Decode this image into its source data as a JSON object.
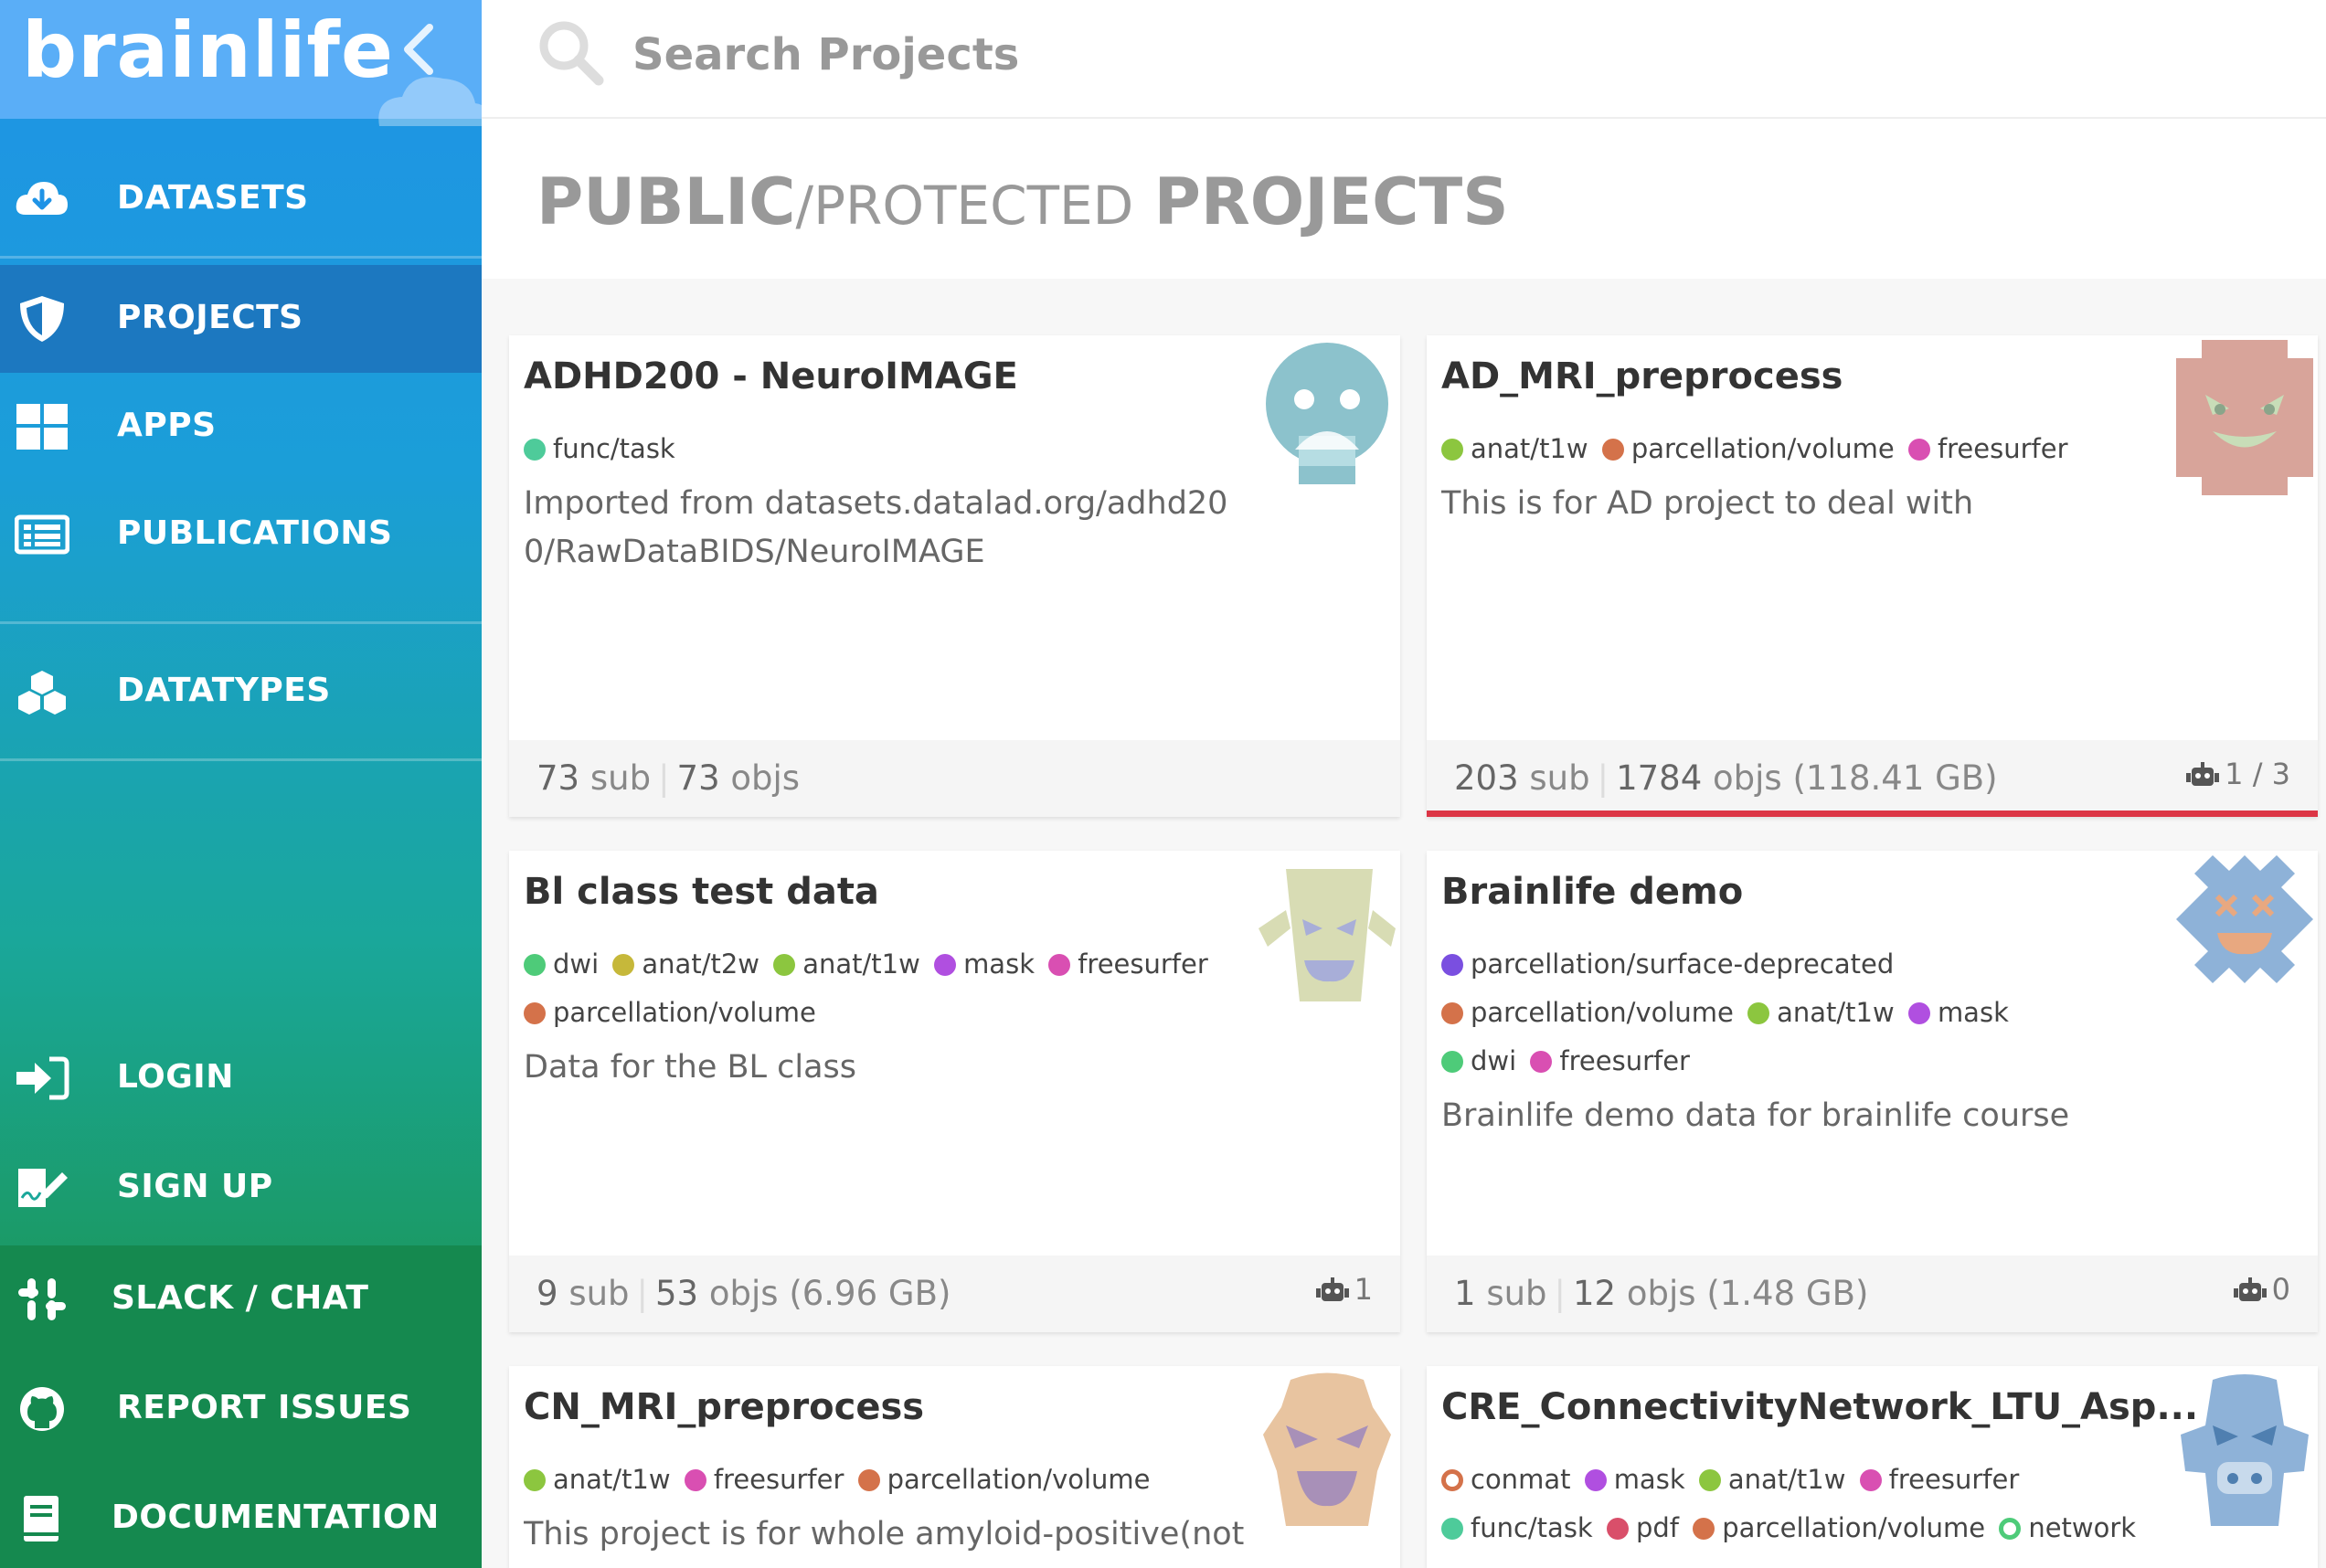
{
  "brand": {
    "logo_text": "brainlife"
  },
  "search": {
    "placeholder": "Search Projects"
  },
  "nav": {
    "datasets": "DATASETS",
    "projects": "PROJECTS",
    "apps": "APPS",
    "publications": "PUBLICATIONS",
    "datatypes": "DATATYPES",
    "login": "LOGIN",
    "signup": "SIGN UP",
    "slack": "SLACK / CHAT",
    "issues": "REPORT ISSUES",
    "docs": "DOCUMENTATION"
  },
  "header": {
    "title_public": "PUBLIC",
    "title_protected": "/PROTECTED",
    "title_projects": "PROJECTS"
  },
  "colors": {
    "active_nav": "#1c78c0",
    "red_bar": "#dc3545"
  },
  "projects": [
    {
      "name": "ADHD200 - NeuroIMAGE",
      "tags": [
        {
          "label": "func/task",
          "color": "#4ecb9a"
        }
      ],
      "desc": "Imported from datasets.datalad.org/adhd200/RawDataBIDS/NeuroIMAGE",
      "sub_count": "73",
      "sub_label": "sub",
      "obj_count": "73",
      "obj_label": "objs",
      "size": "",
      "runs": "",
      "avatar": "ghost-avatar"
    },
    {
      "name": "AD_MRI_preprocess",
      "tags": [
        {
          "label": "anat/t1w",
          "color": "#8cc63f"
        },
        {
          "label": "parcellation/volume",
          "color": "#d4724a"
        },
        {
          "label": "freesurfer",
          "color": "#d94fb2"
        }
      ],
      "desc": "This is for AD project to deal with",
      "sub_count": "203",
      "sub_label": "sub",
      "obj_count": "1784",
      "obj_label": "objs",
      "size": "(118.41 GB)",
      "runs": "1 / 3",
      "avatar": "monster-avatar"
    },
    {
      "name": "Bl class test data",
      "tags": [
        {
          "label": "dwi",
          "color": "#4ecb79"
        },
        {
          "label": "anat/t2w",
          "color": "#c6b83a"
        },
        {
          "label": "anat/t1w",
          "color": "#8cc63f"
        },
        {
          "label": "mask",
          "color": "#b04fe0"
        },
        {
          "label": "freesurfer",
          "color": "#d94fb2"
        },
        {
          "label": "parcellation/volume",
          "color": "#d4724a"
        }
      ],
      "desc": "Data for the BL class",
      "sub_count": "9",
      "sub_label": "sub",
      "obj_count": "53",
      "obj_label": "objs",
      "size": "(6.96 GB)",
      "runs": "1",
      "avatar": "mask-avatar"
    },
    {
      "name": "Brainlife demo",
      "tags": [
        {
          "label": "parcellation/surface-deprecated",
          "color": "#7a4fe0"
        },
        {
          "label": "parcellation/volume",
          "color": "#d4724a"
        },
        {
          "label": "anat/t1w",
          "color": "#8cc63f"
        },
        {
          "label": "mask",
          "color": "#b04fe0"
        },
        {
          "label": "dwi",
          "color": "#4ecb79"
        },
        {
          "label": "freesurfer",
          "color": "#d94fb2"
        }
      ],
      "desc": "Brainlife demo data for brainlife course",
      "sub_count": "1",
      "sub_label": "sub",
      "obj_count": "12",
      "obj_label": "objs",
      "size": "(1.48 GB)",
      "runs": "0",
      "avatar": "diamond-avatar"
    },
    {
      "name": "CN_MRI_preprocess",
      "tags": [
        {
          "label": "anat/t1w",
          "color": "#8cc63f"
        },
        {
          "label": "freesurfer",
          "color": "#d94fb2"
        },
        {
          "label": "parcellation/volume",
          "color": "#d4724a"
        }
      ],
      "desc": "This project is for whole amyloid-positive(not",
      "sub_count": "",
      "sub_label": "",
      "obj_count": "",
      "obj_label": "",
      "size": "",
      "runs": "",
      "avatar": "ogre-avatar"
    },
    {
      "name": "CRE_ConnectivityNetwork_LTU_Asp...",
      "tags": [
        {
          "label": "conmat",
          "color": "#d4724a",
          "ring": true
        },
        {
          "label": "mask",
          "color": "#b04fe0"
        },
        {
          "label": "anat/t1w",
          "color": "#8cc63f"
        },
        {
          "label": "freesurfer",
          "color": "#d94fb2"
        },
        {
          "label": "func/task",
          "color": "#4ecb9a"
        },
        {
          "label": "pdf",
          "color": "#d94f6a"
        },
        {
          "label": "parcellation/volume",
          "color": "#d4724a"
        },
        {
          "label": "network",
          "color": "#4ecb79",
          "ring": true
        }
      ],
      "desc": "",
      "sub_count": "",
      "sub_label": "",
      "obj_count": "",
      "obj_label": "",
      "size": "",
      "runs": "",
      "avatar": "robot-avatar"
    }
  ]
}
